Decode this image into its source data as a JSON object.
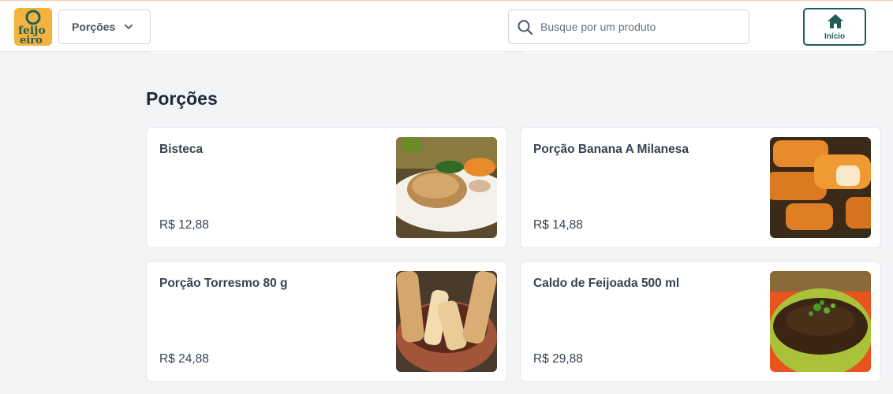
{
  "header": {
    "logo_alt": "O feijoeiro",
    "category_select": {
      "selected": "Porções",
      "icon": "chevron-down-icon"
    },
    "search": {
      "placeholder": "Busque por um produto",
      "value": "",
      "icon": "search-icon"
    },
    "home_button": {
      "label": "Início",
      "icon": "home-icon"
    }
  },
  "section": {
    "title": "Porções"
  },
  "products": [
    {
      "name": "Bisteca",
      "price": "R$ 12,88",
      "image": "grilled-pork-chop-photo"
    },
    {
      "name": "Porção Banana A Milanesa",
      "price": "R$ 14,88",
      "image": "breaded-banana-photo"
    },
    {
      "name": "Porção Torresmo 80 g",
      "price": "R$ 24,88",
      "image": "pork-crackling-photo"
    },
    {
      "name": "Caldo de Feijoada 500 ml",
      "price": "R$ 29,88",
      "image": "bean-broth-photo"
    }
  ],
  "colors": {
    "brand": "#1f5f57",
    "logo_bg": "#f5b23e",
    "page_bg": "#f3f4f6"
  }
}
